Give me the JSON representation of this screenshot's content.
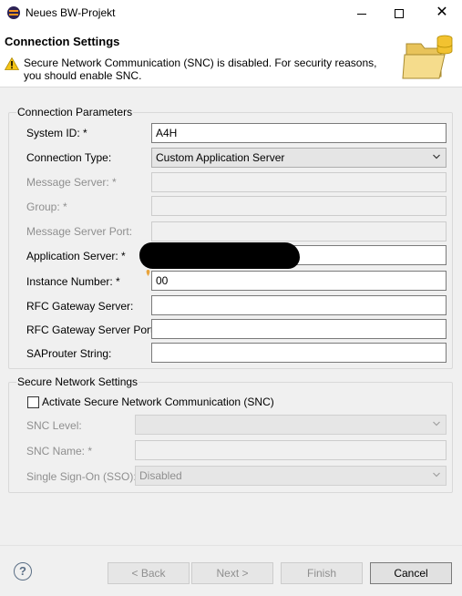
{
  "window": {
    "title": "Neues BW-Projekt",
    "minimize_glyph": "",
    "close_glyph": "✕"
  },
  "header": {
    "title": "Connection Settings",
    "message": "Secure Network Communication (SNC) is disabled. For security reasons, you should enable SNC.",
    "warning_icon": "warning-triangle-icon",
    "banner_icon": "folder-database-icon"
  },
  "connection_parameters": {
    "legend": "Connection Parameters",
    "fields": [
      {
        "label": "System ID: *",
        "value": "A4H",
        "enabled": true
      },
      {
        "label": "Connection Type:",
        "value": "Custom Application Server",
        "enabled": true,
        "type": "select"
      },
      {
        "label": "Message Server: *",
        "value": "",
        "enabled": false
      },
      {
        "label": "Group: *",
        "value": "",
        "enabled": false
      },
      {
        "label": "Message Server Port:",
        "value": "",
        "enabled": false
      },
      {
        "label": "Application Server: *",
        "value": "",
        "enabled": true,
        "redacted": true
      },
      {
        "label": "Instance Number: *",
        "value": "00",
        "enabled": true
      },
      {
        "label": "RFC Gateway Server:",
        "value": "",
        "enabled": true
      },
      {
        "label": "RFC Gateway Server Port:",
        "value": "",
        "enabled": true
      },
      {
        "label": "SAProuter String:",
        "value": "",
        "enabled": true
      }
    ]
  },
  "secure_network": {
    "legend": "Secure Network Settings",
    "activate_snc_label": "Activate Secure Network Communication (SNC)",
    "activate_snc_checked": false,
    "snc_level_label": "SNC Level:",
    "snc_level_value": "",
    "snc_name_label": "SNC Name: *",
    "snc_name_value": "",
    "sso_label": "Single Sign-On (SSO):",
    "sso_value": "Disabled"
  },
  "buttons": {
    "help": "?",
    "back": "< Back",
    "next": "Next >",
    "finish": "Finish",
    "cancel": "Cancel"
  },
  "colors": {
    "background": "#f0f0f0",
    "header_background": "#ffffff",
    "warning": "#f5c518",
    "disabled_text": "#8f8f8f"
  }
}
